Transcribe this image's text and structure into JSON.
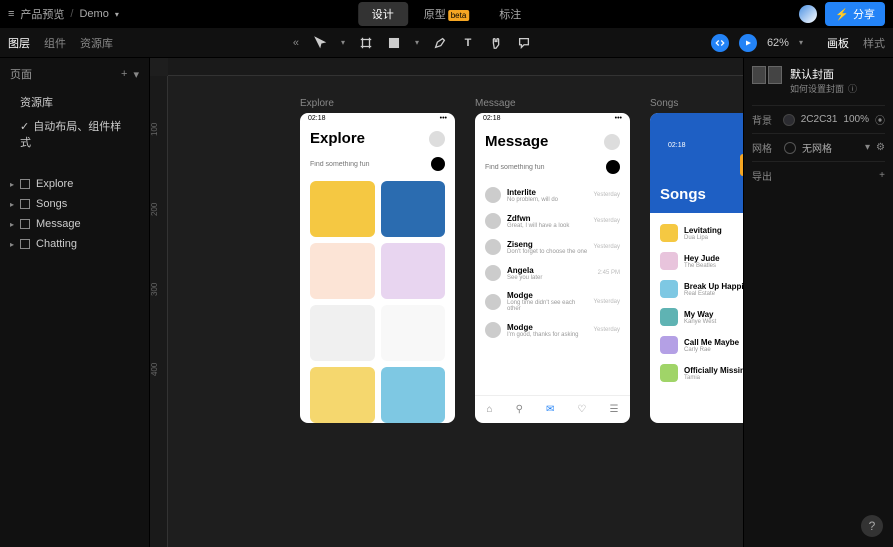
{
  "header": {
    "breadcrumb_root": "产品预览",
    "project": "Demo",
    "tabs": {
      "design": "设计",
      "prototype": "原型",
      "annotate": "标注"
    },
    "share": "分享"
  },
  "toolrow": {
    "left_tabs": {
      "layers": "图层",
      "components": "组件",
      "assets": "资源库"
    },
    "zoom": "62%",
    "right_tabs": {
      "page": "画板",
      "style": "样式"
    }
  },
  "left_panel": {
    "pages_title": "页面",
    "asset_lib": "资源库",
    "auto_layout": "自动布局、组件样式",
    "layers": [
      "Explore",
      "Songs",
      "Message",
      "Chatting"
    ]
  },
  "canvas": {
    "ruler_ticks": [
      "100",
      "200",
      "300",
      "400"
    ],
    "frames": {
      "explore": {
        "label": "Explore",
        "time": "02:18",
        "title": "Explore",
        "search_placeholder": "Find something fun"
      },
      "message": {
        "label": "Message",
        "time": "02:18",
        "title": "Message",
        "search_placeholder": "Find something fun",
        "items": [
          {
            "name": "Interlite",
            "sub": "No problem, will do",
            "time": "Yesterday"
          },
          {
            "name": "Zdfwn",
            "sub": "Great, I will have a look",
            "time": "Yesterday"
          },
          {
            "name": "Ziseng",
            "sub": "Don't forget to choose the one",
            "time": "Yesterday"
          },
          {
            "name": "Angela",
            "sub": "See you later",
            "time": "2:45 PM"
          },
          {
            "name": "Modge",
            "sub": "Long time didn't see each other",
            "time": "Yesterday"
          },
          {
            "name": "Modge",
            "sub": "I'm good, thanks for asking",
            "time": "Yesterday"
          }
        ]
      },
      "songs": {
        "label": "Songs",
        "time": "02:18",
        "title": "Songs",
        "items": [
          {
            "t": "Levitating",
            "s": "Dua Lipa",
            "c": "sc-y"
          },
          {
            "t": "Hey Jude",
            "s": "The Beatles",
            "c": "sc-p"
          },
          {
            "t": "Break Up Happily",
            "s": "Real Estate",
            "c": "sc-b"
          },
          {
            "t": "My Way",
            "s": "Kanye West",
            "c": "sc-t"
          },
          {
            "t": "Call Me Maybe",
            "s": "Carly Rae",
            "c": "sc-v"
          },
          {
            "t": "Officially Missing You",
            "s": "Tamia",
            "c": "sc-g"
          }
        ]
      }
    }
  },
  "right_panel": {
    "title": "默认封面",
    "subtitle": "如何设置封面",
    "bg_label": "背景",
    "bg_value": "2C2C31",
    "bg_pct": "100%",
    "grid_label": "网格",
    "grid_value": "无网格",
    "export_label": "导出"
  }
}
